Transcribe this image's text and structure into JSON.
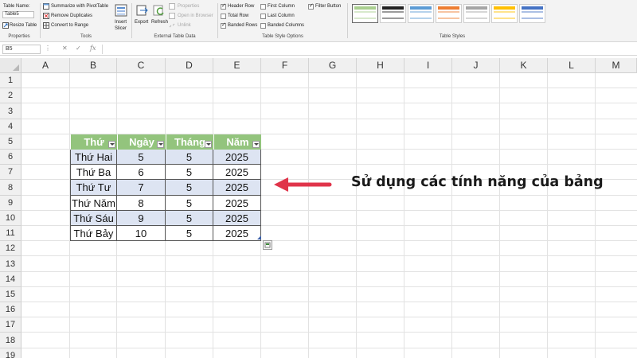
{
  "ribbon": {
    "properties": {
      "table_name_label": "Table Name:",
      "table_name_value": "Table5",
      "resize_label": "Resize Table",
      "group_label": "Properties"
    },
    "tools": {
      "summarize_label": "Summarize with PivotTable",
      "remove_dup_label": "Remove Duplicates",
      "convert_label": "Convert to Range",
      "insert_slicer_line1": "Insert",
      "insert_slicer_line2": "Slicer",
      "group_label": "Tools"
    },
    "external": {
      "export_label": "Export",
      "refresh_label": "Refresh",
      "properties_label": "Properties",
      "open_browser_label": "Open in Browser",
      "unlink_label": "Unlink",
      "group_label": "External Table Data"
    },
    "style_options": {
      "header_row": "Header Row",
      "total_row": "Total Row",
      "banded_rows": "Banded Rows",
      "first_column": "First Column",
      "last_column": "Last Column",
      "banded_columns": "Banded Columns",
      "filter_button": "Filter Button",
      "group_label": "Table Style Options",
      "checked": {
        "header_row": true,
        "total_row": false,
        "banded_rows": true,
        "first_column": false,
        "last_column": false,
        "banded_columns": false,
        "filter_button": true
      }
    },
    "table_styles": {
      "group_label": "Table Styles",
      "swatch_colors": [
        "#a9cf8f",
        "#222222",
        "#5b9bd5",
        "#ed7d31",
        "#a5a5a5",
        "#ffc000",
        "#4472c4"
      ]
    }
  },
  "formula_bar": {
    "name_box": "B5",
    "cancel_icon": "✕",
    "enter_icon": "✓",
    "fx_label": "fx",
    "value": ""
  },
  "grid": {
    "columns": [
      "A",
      "B",
      "C",
      "D",
      "E",
      "F",
      "G",
      "H",
      "I",
      "J",
      "K",
      "L",
      "M"
    ],
    "rows": [
      "1",
      "2",
      "3",
      "4",
      "5",
      "6",
      "7",
      "8",
      "9",
      "10",
      "11",
      "12",
      "13",
      "14",
      "15",
      "16",
      "17",
      "18",
      "19"
    ]
  },
  "table": {
    "headers": [
      "Thứ",
      "Ngày",
      "Tháng",
      "Năm"
    ],
    "rows": [
      [
        "Thứ Hai",
        "5",
        "5",
        "2025"
      ],
      [
        "Thứ Ba",
        "6",
        "5",
        "2025"
      ],
      [
        "Thứ Tư",
        "7",
        "5",
        "2025"
      ],
      [
        "Thứ Năm",
        "8",
        "5",
        "2025"
      ],
      [
        "Thứ Sáu",
        "9",
        "5",
        "2025"
      ],
      [
        "Thứ Bảy",
        "10",
        "5",
        "2025"
      ]
    ],
    "header_color": "#93c47d",
    "band_color": "#dde4f2"
  },
  "annotation": {
    "text": "Sử dụng các tính năng của bảng",
    "arrow_color": "#e0344a"
  }
}
